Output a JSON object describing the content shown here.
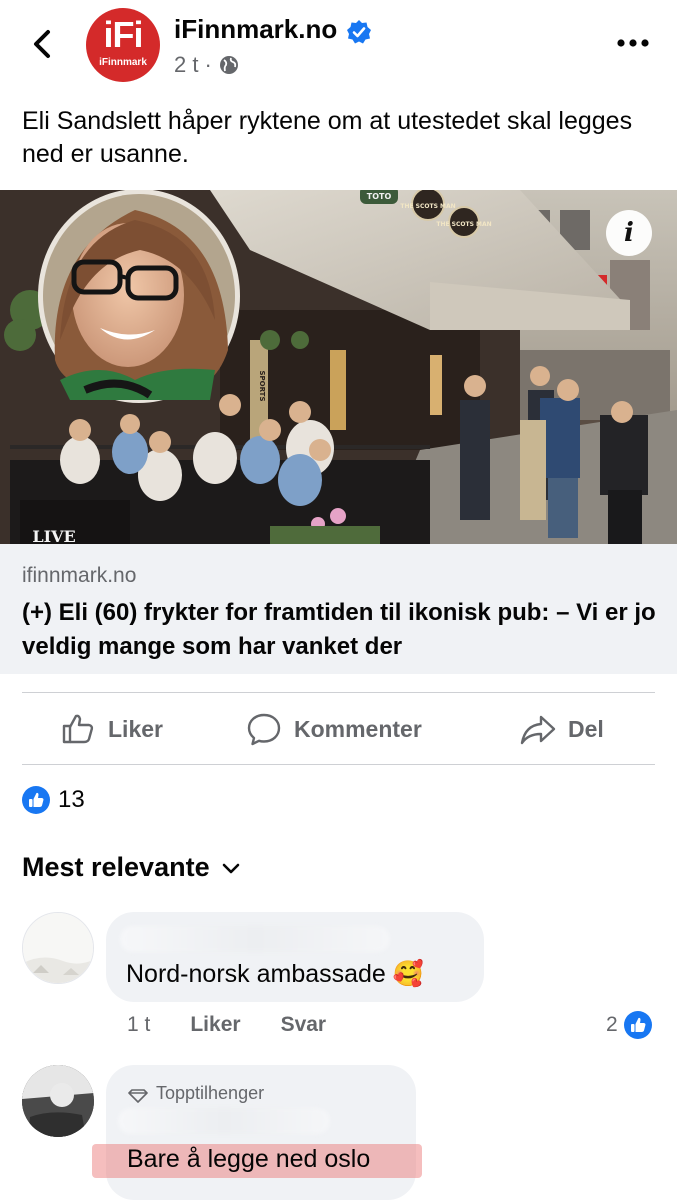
{
  "post": {
    "page_name": "iFinnmark.no",
    "logo_text": "iFi",
    "logo_subtext": "iFinnmark",
    "time": "2 t",
    "separator": "·",
    "text": "Eli Sandslett håper ryktene om at utestedet skal legges ned er usanne."
  },
  "link": {
    "domain": "ifinnmark.no",
    "title": "(+) Eli (60) frykter for framtiden til ikonisk pub: – Vi er jo veldig mange som har vanket der",
    "info_label": "i",
    "photo_signs": [
      "TOTO",
      "THE SCOTS MAN",
      "THE SCOTS MAN",
      "LIVE",
      "SPORTS"
    ]
  },
  "actions": {
    "like": "Liker",
    "comment": "Kommenter",
    "share": "Del"
  },
  "reactions": {
    "count": "13"
  },
  "comments_sort": "Mest relevante",
  "comments": [
    {
      "text": "Nord-norsk ambassade 🥰",
      "time": "1 t",
      "like": "Liker",
      "reply": "Svar",
      "likes": "2"
    },
    {
      "badge": "Topptilhenger",
      "text": "Bare å legge ned oslo"
    }
  ],
  "colors": {
    "facebook_blue": "#1877f2",
    "logo_red": "#d42a2a",
    "secondary_text": "#65676b",
    "bubble": "#f0f2f5"
  },
  "icons": {
    "back": "back-arrow-icon",
    "verified": "verified-badge-icon",
    "globe": "globe-icon",
    "more": "more-dots-icon",
    "like": "thumbs-up-icon",
    "comment": "speech-bubble-icon",
    "share": "share-arrow-icon"
  }
}
